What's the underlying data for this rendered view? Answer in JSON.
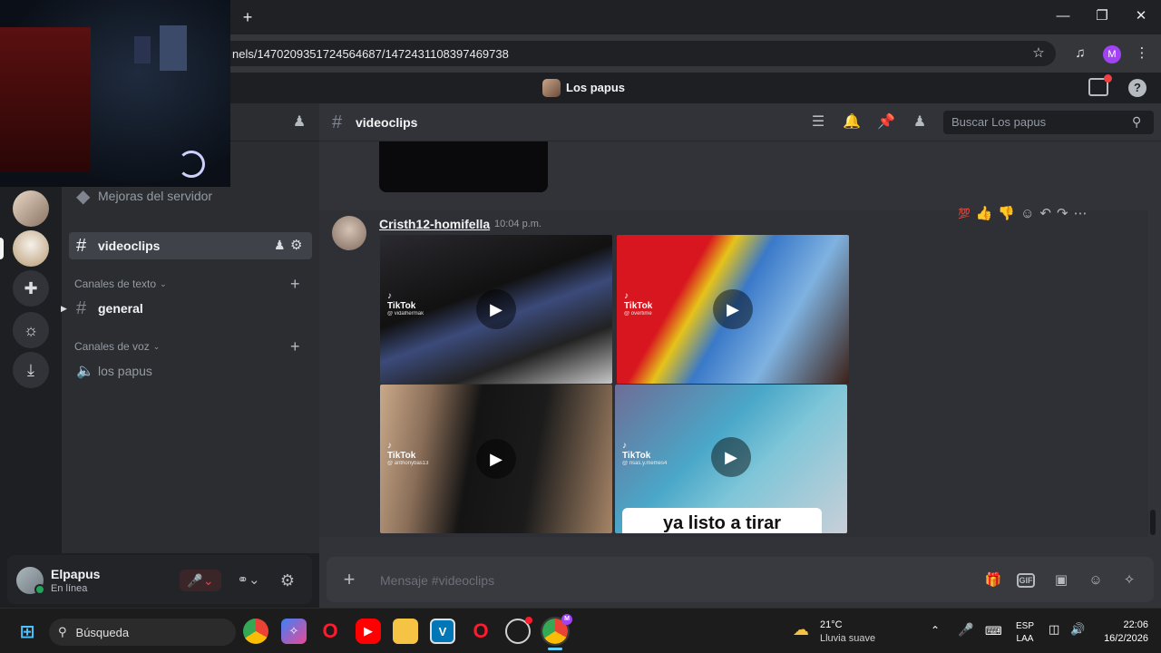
{
  "browser": {
    "url": "nels/1470209351724564687/1472431108397469738",
    "new_tab_label": "+",
    "profile_initial": "M"
  },
  "discord": {
    "server_name": "Los papus",
    "sidebar": {
      "boost_item": "Mejoras del servidor",
      "active_channel": "videoclips",
      "text_category": "Canales de texto",
      "text_channels": [
        "general"
      ],
      "voice_category": "Canales de voz",
      "voice_channels": [
        "los papus"
      ]
    },
    "user": {
      "name": "Elpapus",
      "status": "En línea"
    },
    "chat": {
      "channel": "videoclips",
      "search_placeholder": "Buscar Los papus",
      "message": {
        "author": "Cristh12-homifella",
        "timestamp": "10:04 p.m.",
        "videos": [
          {
            "brand": "TikTok",
            "handle": "@ vidalhermak"
          },
          {
            "brand": "TikTok",
            "handle": "@ overtime"
          },
          {
            "brand": "TikTok",
            "handle": "@ anthonybas13"
          },
          {
            "brand": "TikTok",
            "handle": "@ risas.y.memes4",
            "caption": "ya listo a tirar"
          }
        ]
      },
      "composer_placeholder": "Mensaje #videoclips",
      "gif_label": "GIF"
    }
  },
  "taskbar": {
    "search_label": "Búsqueda",
    "weather_temp": "21°C",
    "weather_desc": "Lluvia suave",
    "lang_line1": "ESP",
    "lang_line2": "LAA",
    "time": "22:06",
    "date": "16/2/2026"
  },
  "colors": {
    "discord_bg": "#313338",
    "sidebar_bg": "#2b2d31",
    "rail_bg": "#1e1f22",
    "online": "#23a55a",
    "muted_red": "#f23f43"
  }
}
